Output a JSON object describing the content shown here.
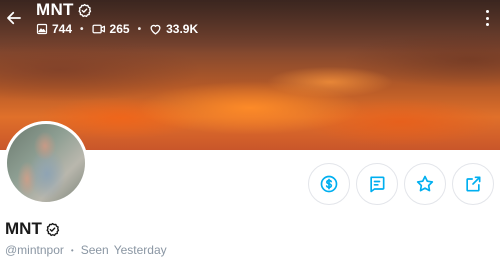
{
  "header": {
    "title": "MNT",
    "stats": {
      "photos": "744",
      "videos": "265",
      "likes": "33.9K"
    }
  },
  "profile": {
    "name": "MNT",
    "handle": "@mintnpor",
    "seen_label": "Seen",
    "seen_value": "Yesterday"
  },
  "colors": {
    "accent": "#00aff0",
    "muted": "#8a96a3",
    "text": "#1a1a1a"
  },
  "icons": [
    "back-arrow-icon",
    "verified-badge-icon",
    "image-icon",
    "video-icon",
    "heart-icon",
    "more-vertical-icon",
    "dollar-icon",
    "message-icon",
    "star-icon",
    "share-icon"
  ]
}
